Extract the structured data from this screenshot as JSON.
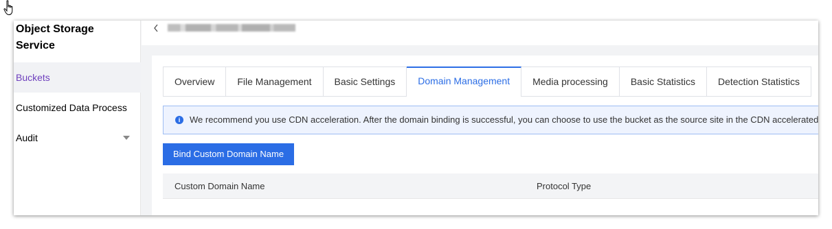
{
  "sidebar": {
    "title": "Object Storage Service",
    "items": [
      {
        "label": "Buckets",
        "active": true
      },
      {
        "label": "Customized Data Process",
        "active": false
      },
      {
        "label": "Audit",
        "active": false,
        "expandable": true
      }
    ]
  },
  "header": {
    "back_icon": "chevron-left-icon"
  },
  "tabs": [
    {
      "label": "Overview",
      "active": false
    },
    {
      "label": "File Management",
      "active": false
    },
    {
      "label": "Basic Settings",
      "active": false
    },
    {
      "label": "Domain Management",
      "active": true
    },
    {
      "label": "Media processing",
      "active": false
    },
    {
      "label": "Basic Statistics",
      "active": false
    },
    {
      "label": "Detection Statistics",
      "active": false
    }
  ],
  "notice": {
    "icon": "info-icon",
    "text": "We recommend you use CDN acceleration. After the domain binding is successful, you can choose to use the bucket as the source site in the CDN accelerated"
  },
  "actions": {
    "bind_label": "Bind Custom Domain Name"
  },
  "table": {
    "columns": [
      "Custom Domain Name",
      "Protocol Type"
    ]
  },
  "colors": {
    "accent": "#2b6de5",
    "active_sidebar_text": "#6e3fbd",
    "notice_bg": "#eef3fe"
  }
}
